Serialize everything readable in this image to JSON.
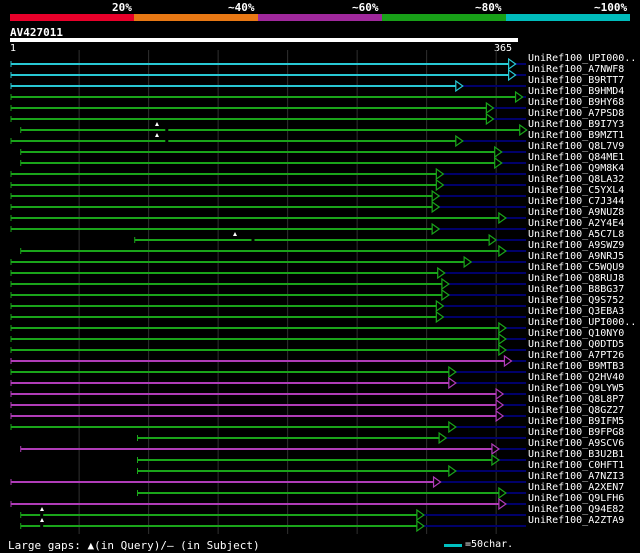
{
  "legend": [
    {
      "label": "20%",
      "color": "#e8002a"
    },
    {
      "label": "~40%",
      "color": "#e87814"
    },
    {
      "label": "~60%",
      "color": "#a0289c"
    },
    {
      "label": "~80%",
      "color": "#18a018"
    },
    {
      "label": "~100%",
      "color": "#00bcbc"
    }
  ],
  "query": {
    "name": "AV427011",
    "start": "1",
    "end": "365"
  },
  "colors": {
    "cyan": "#28c8d4",
    "green": "#1aa51a",
    "magenta": "#b03cb8",
    "navy": "#00006a",
    "grid": "#303030"
  },
  "hits": [
    {
      "label": "UniRef100_UPI000..",
      "color": "cyan",
      "start": 1,
      "end": 364,
      "gaps": []
    },
    {
      "label": "UniRef100_A7NWF8",
      "color": "cyan",
      "start": 1,
      "end": 364,
      "gaps": []
    },
    {
      "label": "UniRef100_B9RTT7",
      "color": "cyan",
      "start": 1,
      "end": 326,
      "gaps": []
    },
    {
      "label": "UniRef100_B9HMD4",
      "color": "green",
      "start": 1,
      "end": 369,
      "gaps": []
    },
    {
      "label": "UniRef100_B9HY68",
      "color": "green",
      "start": 1,
      "end": 348,
      "gaps": []
    },
    {
      "label": "UniRef100_A7PSD8",
      "color": "green",
      "start": 1,
      "end": 348,
      "gaps": []
    },
    {
      "label": "UniRef100_B9I7Y3",
      "color": "green",
      "start": 8,
      "end": 372,
      "gaps": [
        112
      ]
    },
    {
      "label": "UniRef100_B9MZT1",
      "color": "green",
      "start": 1,
      "end": 326,
      "gaps": [
        112
      ]
    },
    {
      "label": "UniRef100_Q8L7V9",
      "color": "green",
      "start": 8,
      "end": 354,
      "gaps": []
    },
    {
      "label": "UniRef100_Q84ME1",
      "color": "green",
      "start": 8,
      "end": 354,
      "gaps": []
    },
    {
      "label": "UniRef100_Q9M8K4",
      "color": "green",
      "start": 1,
      "end": 312,
      "gaps": []
    },
    {
      "label": "UniRef100_Q8LA32",
      "color": "green",
      "start": 1,
      "end": 312,
      "gaps": []
    },
    {
      "label": "UniRef100_C5YXL4",
      "color": "green",
      "start": 1,
      "end": 309,
      "gaps": []
    },
    {
      "label": "UniRef100_C7J344",
      "color": "green",
      "start": 1,
      "end": 309,
      "gaps": []
    },
    {
      "label": "UniRef100_A9NUZ8",
      "color": "green",
      "start": 1,
      "end": 357,
      "gaps": []
    },
    {
      "label": "UniRef100_A2Y4E4",
      "color": "green",
      "start": 1,
      "end": 309,
      "gaps": []
    },
    {
      "label": "UniRef100_A5C7L8",
      "color": "green",
      "start": 90,
      "end": 350,
      "gaps": [
        174
      ]
    },
    {
      "label": "UniRef100_A9SWZ9",
      "color": "green",
      "start": 8,
      "end": 357,
      "gaps": []
    },
    {
      "label": "UniRef100_A9NRJ5",
      "color": "green",
      "start": 1,
      "end": 332,
      "gaps": []
    },
    {
      "label": "UniRef100_C5WQU9",
      "color": "green",
      "start": 1,
      "end": 313,
      "gaps": []
    },
    {
      "label": "UniRef100_Q8RUJ8",
      "color": "green",
      "start": 1,
      "end": 316,
      "gaps": []
    },
    {
      "label": "UniRef100_B8BG37",
      "color": "green",
      "start": 1,
      "end": 316,
      "gaps": []
    },
    {
      "label": "UniRef100_Q9S752",
      "color": "green",
      "start": 1,
      "end": 312,
      "gaps": []
    },
    {
      "label": "UniRef100_Q3EBA3",
      "color": "green",
      "start": 1,
      "end": 312,
      "gaps": []
    },
    {
      "label": "UniRef100_UPI000..",
      "color": "green",
      "start": 1,
      "end": 357,
      "gaps": []
    },
    {
      "label": "UniRef100_Q10NY0",
      "color": "green",
      "start": 1,
      "end": 357,
      "gaps": []
    },
    {
      "label": "UniRef100_Q0DTD5",
      "color": "green",
      "start": 1,
      "end": 357,
      "gaps": []
    },
    {
      "label": "UniRef100_A7PT26",
      "color": "magenta",
      "start": 1,
      "end": 361,
      "gaps": []
    },
    {
      "label": "UniRef100_B9MTB3",
      "color": "green",
      "start": 1,
      "end": 321,
      "gaps": []
    },
    {
      "label": "UniRef100_Q2HV40",
      "color": "magenta",
      "start": 1,
      "end": 321,
      "gaps": []
    },
    {
      "label": "UniRef100_Q9LYW5",
      "color": "magenta",
      "start": 1,
      "end": 355,
      "gaps": []
    },
    {
      "label": "UniRef100_Q8L8P7",
      "color": "magenta",
      "start": 1,
      "end": 355,
      "gaps": []
    },
    {
      "label": "UniRef100_Q8GZ27",
      "color": "magenta",
      "start": 1,
      "end": 355,
      "gaps": []
    },
    {
      "label": "UniRef100_B9IFM5",
      "color": "green",
      "start": 1,
      "end": 321,
      "gaps": []
    },
    {
      "label": "UniRef100_B9FPG8",
      "color": "green",
      "start": 92,
      "end": 314,
      "gaps": []
    },
    {
      "label": "UniRef100_A9SCV6",
      "color": "magenta",
      "start": 8,
      "end": 352,
      "gaps": []
    },
    {
      "label": "UniRef100_B3U2B1",
      "color": "green",
      "start": 92,
      "end": 352,
      "gaps": []
    },
    {
      "label": "UniRef100_C0HFT1",
      "color": "green",
      "start": 92,
      "end": 321,
      "gaps": []
    },
    {
      "label": "UniRef100_A7NZI3",
      "color": "magenta",
      "start": 1,
      "end": 310,
      "gaps": []
    },
    {
      "label": "UniRef100_A2XEN7",
      "color": "green",
      "start": 92,
      "end": 357,
      "gaps": []
    },
    {
      "label": "UniRef100_Q9LFH6",
      "color": "magenta",
      "start": 1,
      "end": 357,
      "gaps": []
    },
    {
      "label": "UniRef100_Q94E82",
      "color": "green",
      "start": 8,
      "end": 298,
      "gaps": [
        22
      ]
    },
    {
      "label": "UniRef100_A2ZTA9",
      "color": "green",
      "start": 8,
      "end": 298,
      "gaps": [
        22
      ]
    }
  ],
  "footer": {
    "gaps_text": "Large gaps: ▲(in Query)/– (in Subject)",
    "scale_text": "=50char."
  }
}
